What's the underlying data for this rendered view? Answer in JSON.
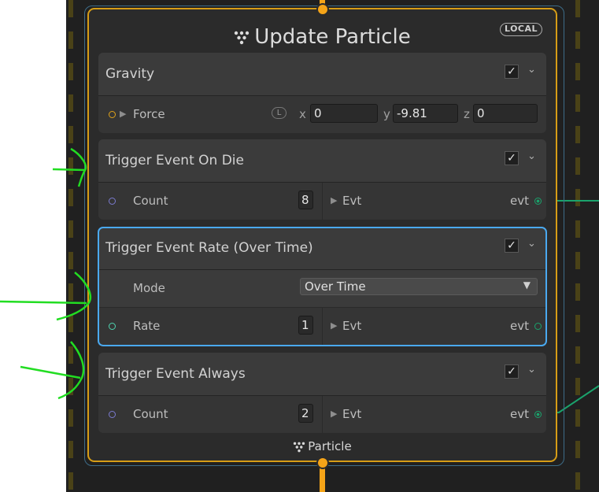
{
  "node": {
    "title": "Update Particle",
    "badge": "LOCAL",
    "output_label": "Particle",
    "title_icon": "particle-system-icon"
  },
  "colors": {
    "accent_orange": "#f5a418",
    "selection_blue": "#4aa9f0",
    "event_green": "#1aa36c",
    "annotation_green": "#22dd22"
  },
  "blocks": {
    "gravity": {
      "title": "Gravity",
      "checkbox": "✓",
      "chevron": "⌄",
      "force": {
        "label": "Force",
        "space": "L",
        "x_label": "x",
        "x": "0",
        "y_label": "y",
        "y": "-9.81",
        "z_label": "z",
        "z": "0"
      }
    },
    "on_die": {
      "title": "Trigger Event On Die",
      "checkbox": "✓",
      "chevron": "⌄",
      "count_label": "Count",
      "count": "8",
      "evt_in": "Evt",
      "evt_out": "evt"
    },
    "rate": {
      "title": "Trigger Event Rate (Over Time)",
      "checkbox": "✓",
      "chevron": "⌄",
      "mode_label": "Mode",
      "mode_value": "Over Time",
      "rate_label": "Rate",
      "rate": "1",
      "evt_in": "Evt",
      "evt_out": "evt"
    },
    "always": {
      "title": "Trigger Event Always",
      "checkbox": "✓",
      "chevron": "⌄",
      "count_label": "Count",
      "count": "2",
      "evt_in": "Evt",
      "evt_out": "evt"
    }
  }
}
